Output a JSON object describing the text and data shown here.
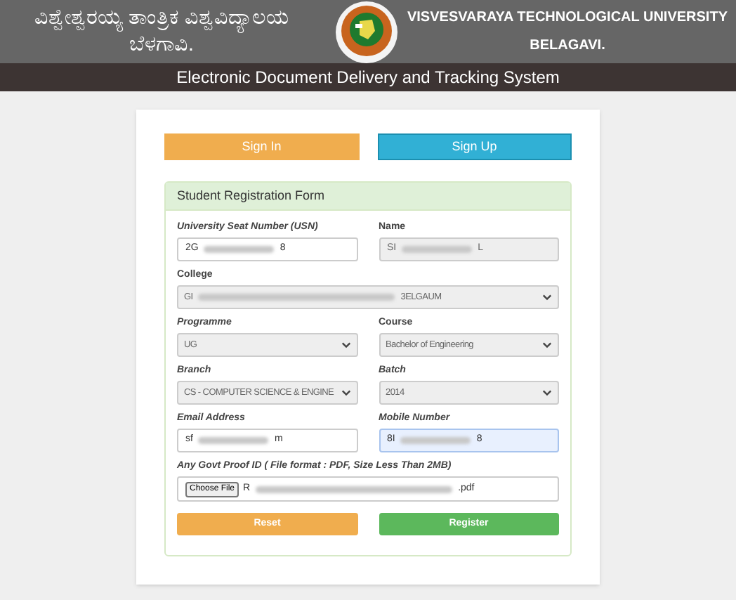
{
  "header": {
    "title_kannada_line1": "ವಿಶ್ವೇಶ್ವರಯ್ಯ ತಾಂತ್ರಿಕ ವಿಶ್ವವಿದ್ಯಾಲಯ",
    "title_kannada_line2": "ಬೆಳಗಾವಿ.",
    "title_english_line1": "VISVESVARAYA TECHNOLOGICAL UNIVERSITY",
    "title_english_line2": "BELAGAVI."
  },
  "system_title": "Electronic Document Delivery and Tracking System",
  "tabs": [
    {
      "label": "Sign In",
      "selected": false
    },
    {
      "label": "Sign Up",
      "selected": true
    }
  ],
  "form": {
    "title": "Student Registration Form",
    "fields": [
      {
        "kind": "input",
        "label": "University Seat Number (USN)",
        "italic": true,
        "readonly": false,
        "focused": false,
        "wide": false,
        "value": "2G",
        "value_end": "8"
      },
      {
        "kind": "input",
        "label": "Name",
        "italic": false,
        "readonly": true,
        "focused": false,
        "wide": false,
        "value": "SI",
        "value_end": "L"
      },
      {
        "kind": "select",
        "label": "College",
        "italic": false,
        "readonly": true,
        "focused": false,
        "wide": true,
        "value": "GI",
        "value_end": "3ELGAUM"
      },
      {
        "kind": "select",
        "label": "Programme",
        "italic": true,
        "readonly": true,
        "focused": false,
        "wide": false,
        "value": "UG"
      },
      {
        "kind": "select",
        "label": "Course",
        "italic": false,
        "readonly": true,
        "focused": false,
        "wide": false,
        "value": "Bachelor of Engineering"
      },
      {
        "kind": "select",
        "label": "Branch",
        "italic": true,
        "readonly": true,
        "focused": false,
        "wide": false,
        "value": "CS - COMPUTER SCIENCE & ENGINE"
      },
      {
        "kind": "select",
        "label": "Batch",
        "italic": true,
        "readonly": true,
        "focused": false,
        "wide": false,
        "value": "2014"
      },
      {
        "kind": "input",
        "label": "Email Address",
        "italic": true,
        "readonly": false,
        "focused": false,
        "wide": false,
        "value": "sf",
        "value_end": "m"
      },
      {
        "kind": "input",
        "label": "Mobile Number",
        "italic": true,
        "readonly": false,
        "focused": true,
        "wide": false,
        "value": "8I",
        "value_end": "8"
      },
      {
        "kind": "file",
        "label": "Any Govt Proof ID ( File format : PDF, Size Less Than 2MB)",
        "italic": true,
        "readonly": false,
        "focused": false,
        "wide": true,
        "button": "Choose File",
        "value": "R",
        "value_end": ".pdf"
      }
    ],
    "buttons": [
      {
        "label": "Reset",
        "kind": "warning"
      },
      {
        "label": "Register",
        "kind": "success"
      }
    ]
  }
}
